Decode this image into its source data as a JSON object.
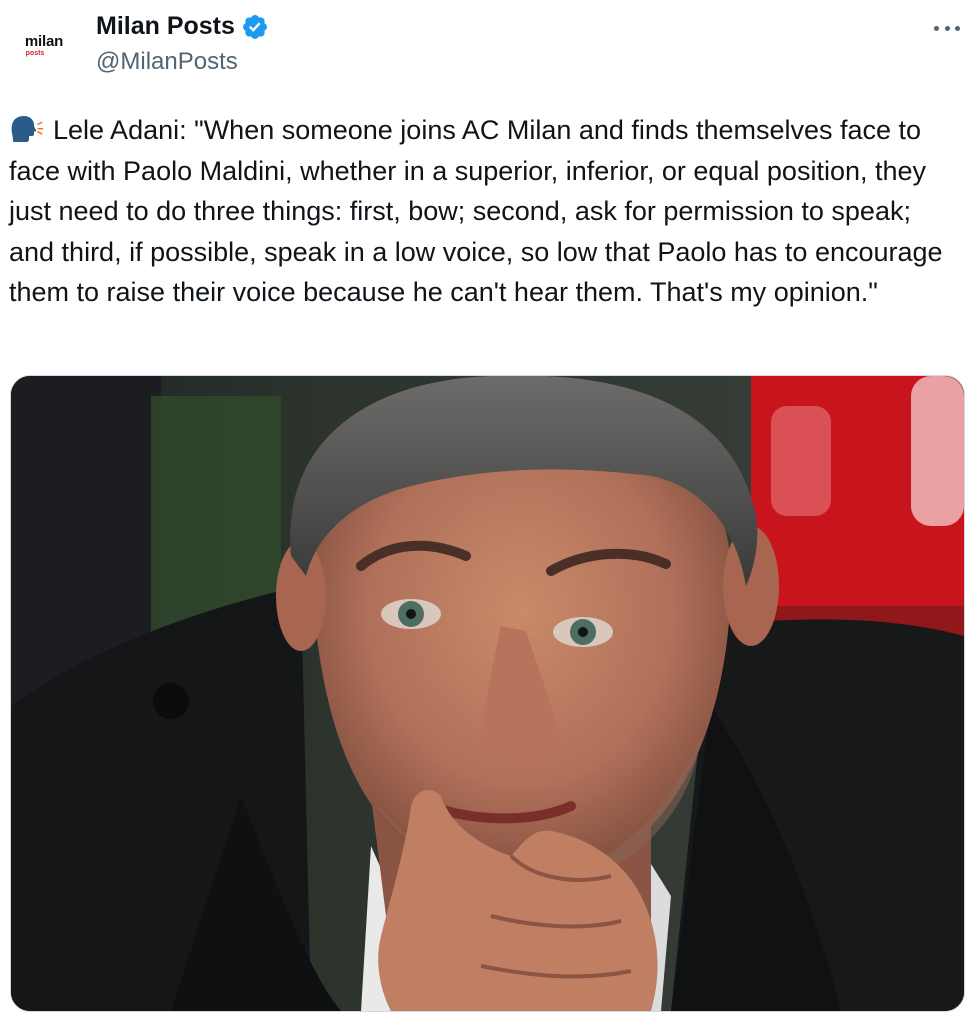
{
  "author": {
    "avatar_main": "milan",
    "avatar_sub": "posts",
    "display_name": "Milan Posts",
    "handle": "@MilanPosts",
    "verified": true
  },
  "tweet": {
    "text": "Lele Adani: \"When someone joins AC Milan and finds themselves face to face with Paolo Maldini, whether in a superior, inferior, or equal position, they just need to do three things: first, bow; second, ask for permission to speak; and third, if possible, speak in a low voice, so low that Paolo has to encourage them to raise their voice because he can't hear them. That's my opinion.\"",
    "leading_icon": "speaking-head-icon"
  },
  "icons": {
    "verified": "verified-badge-icon",
    "more": "more-options-icon"
  },
  "colors": {
    "verified_blue": "#1d9bf0",
    "text_primary": "#0f1419",
    "text_secondary": "#536471",
    "brand_red": "#d4202a"
  }
}
